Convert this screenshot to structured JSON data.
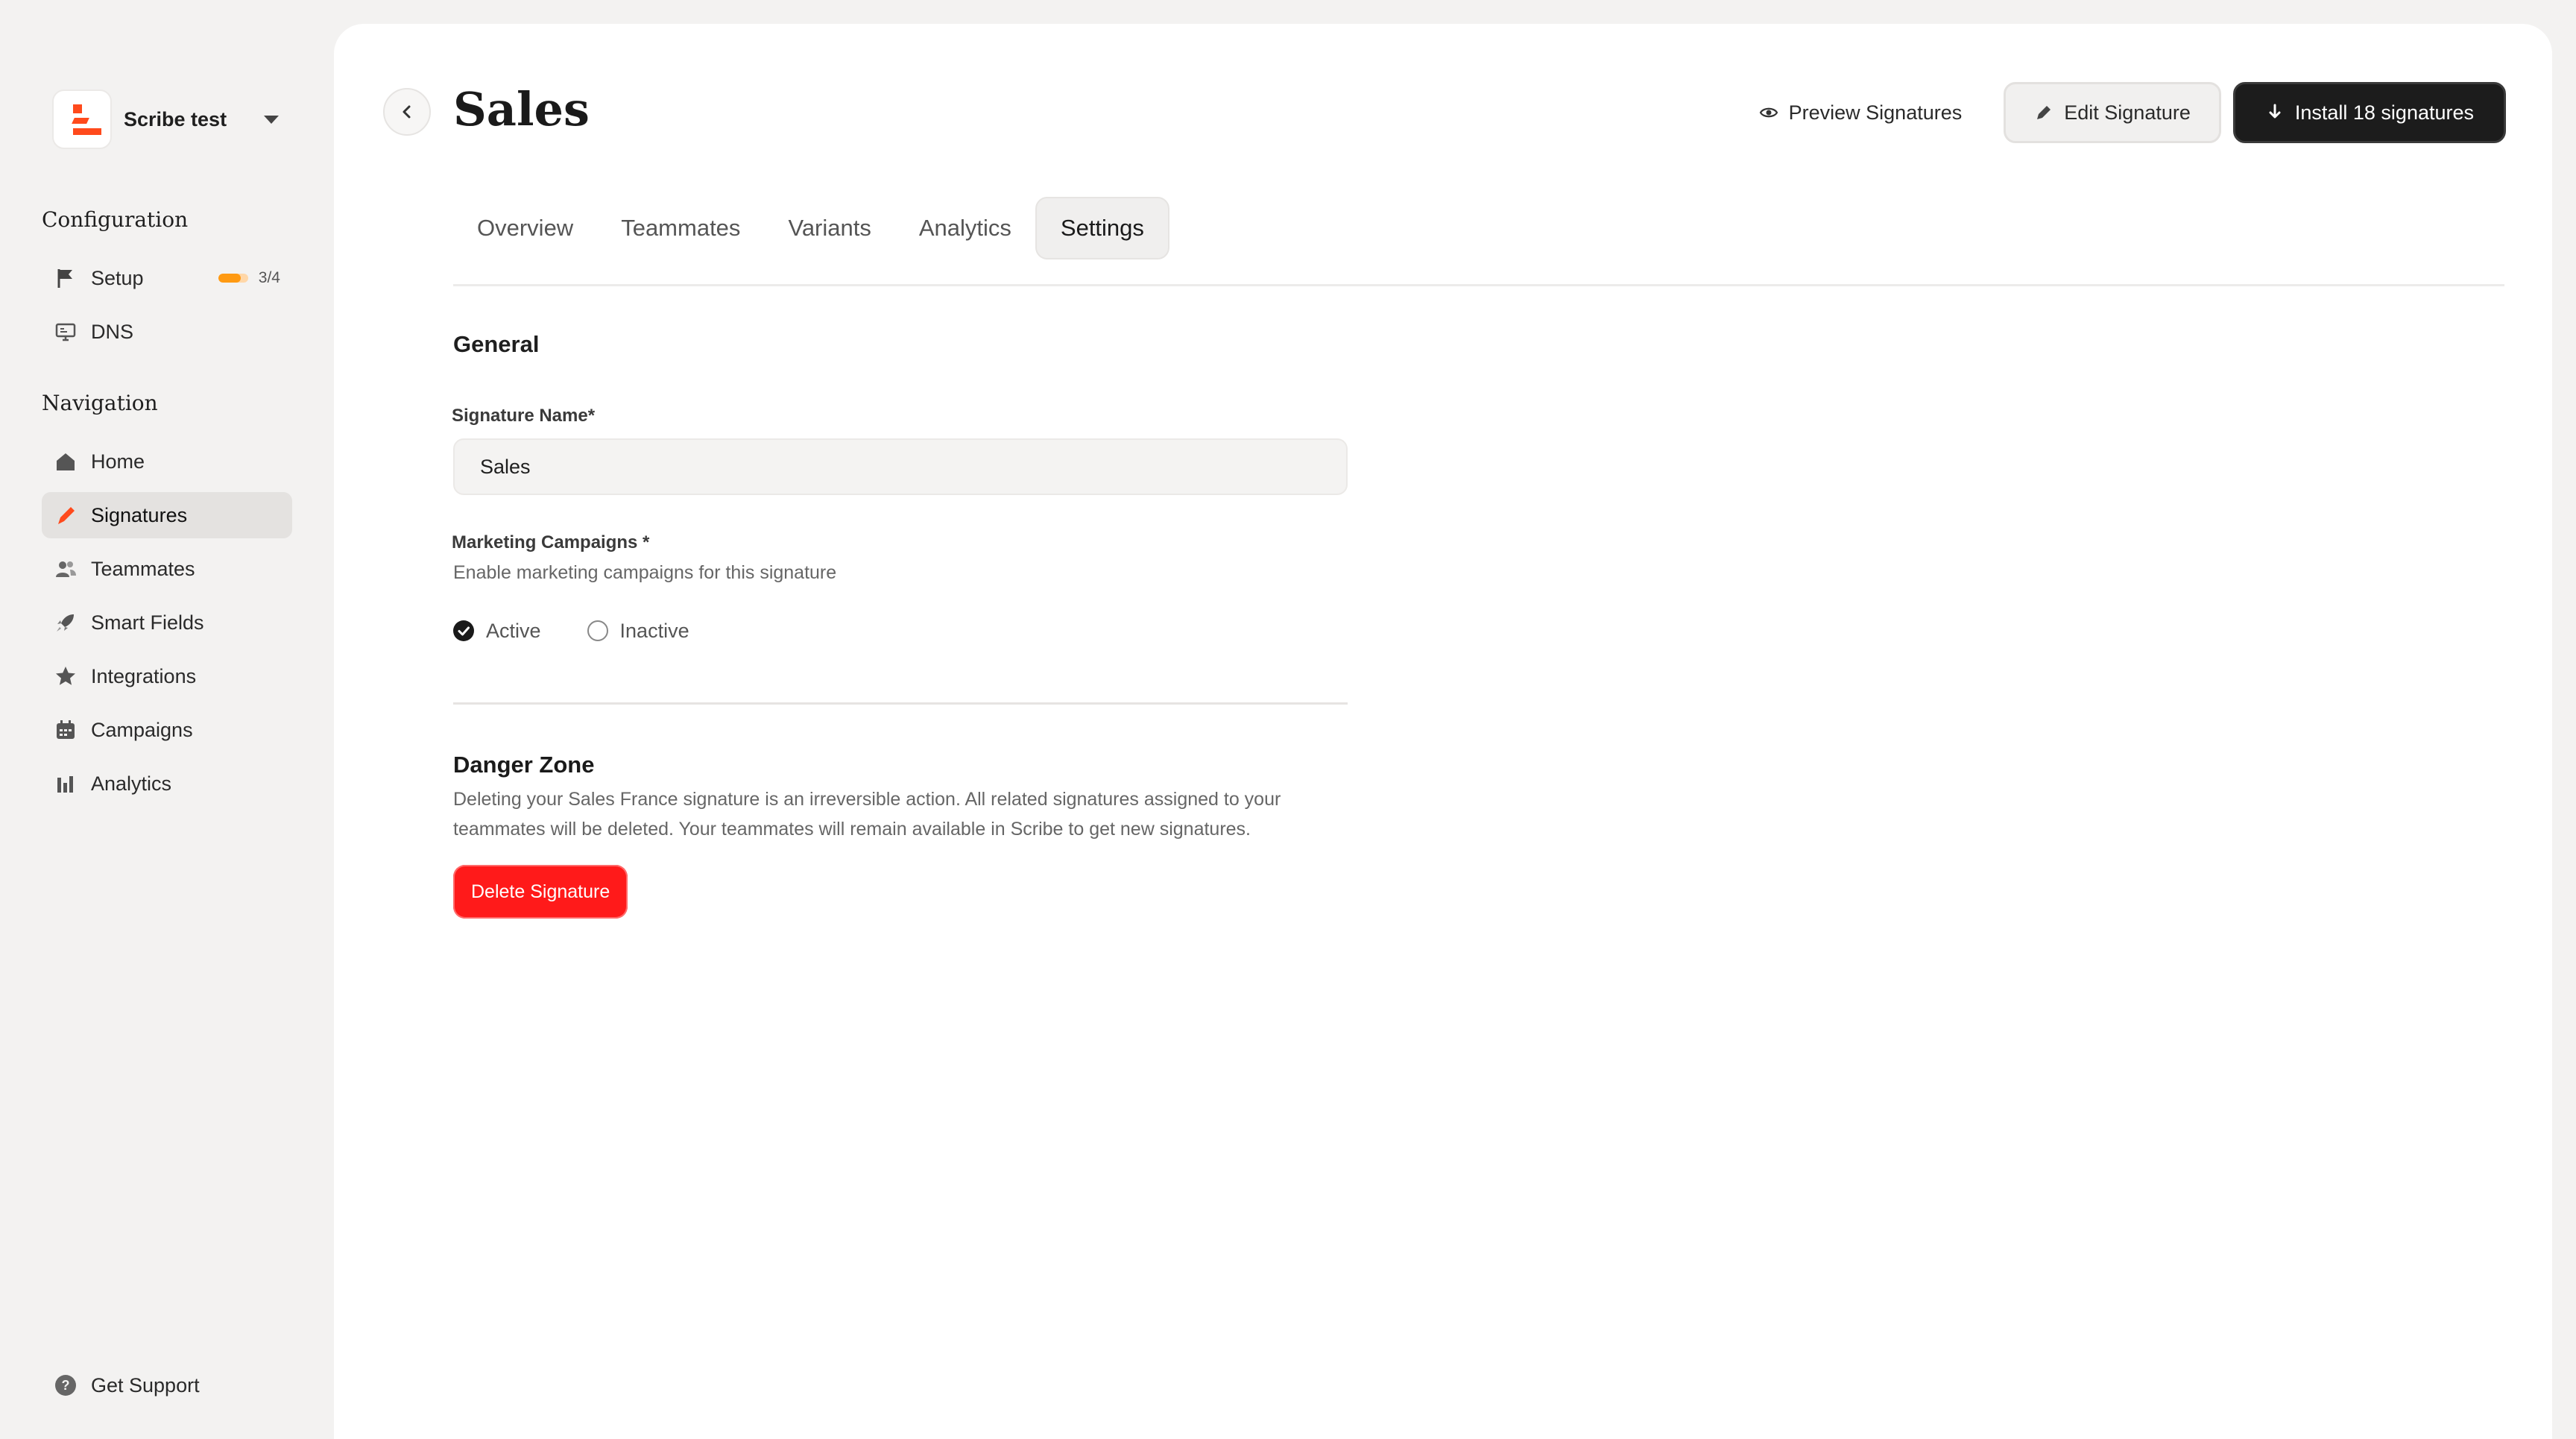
{
  "workspace": {
    "name": "Scribe test"
  },
  "sidebar": {
    "configuration_title": "Configuration",
    "configuration_items": [
      {
        "label": "Setup",
        "icon": "flag-icon",
        "progress_text": "3/4",
        "progress_fraction": 0.75,
        "progress_color": "#ff9a12"
      },
      {
        "label": "DNS",
        "icon": "dns-monitor-icon"
      }
    ],
    "navigation_title": "Navigation",
    "navigation_items": [
      {
        "label": "Home",
        "icon": "home-icon"
      },
      {
        "label": "Signatures",
        "icon": "pen-icon",
        "active": true
      },
      {
        "label": "Teammates",
        "icon": "users-icon"
      },
      {
        "label": "Smart Fields",
        "icon": "rocket-icon"
      },
      {
        "label": "Integrations",
        "icon": "star-icon"
      },
      {
        "label": "Campaigns",
        "icon": "calendar-icon"
      },
      {
        "label": "Analytics",
        "icon": "bar-chart-icon"
      }
    ],
    "support_label": "Get Support"
  },
  "header": {
    "title": "Sales",
    "preview_label": "Preview Signatures",
    "edit_label": "Edit Signature",
    "install_label": "Install 18 signatures"
  },
  "tabs": [
    {
      "label": "Overview"
    },
    {
      "label": "Teammates"
    },
    {
      "label": "Variants"
    },
    {
      "label": "Analytics"
    },
    {
      "label": "Settings",
      "active": true
    }
  ],
  "general": {
    "title": "General",
    "signature_name_label": "Signature Name*",
    "signature_name_value": "Sales",
    "marketing_label": "Marketing Campaigns *",
    "marketing_helper": "Enable marketing campaigns for this signature",
    "option_active": "Active",
    "option_inactive": "Inactive",
    "selected": "Active"
  },
  "danger": {
    "title": "Danger Zone",
    "description": "Deleting your Sales France signature is an irreversible action. All related signatures assigned to your teammates will be deleted. Your teammates will remain available in Scribe to get new signatures.",
    "delete_label": "Delete Signature"
  },
  "colors": {
    "brand": "#ff4a1c",
    "danger": "#ff1a1a",
    "dark_button": "#1c1c1c"
  }
}
